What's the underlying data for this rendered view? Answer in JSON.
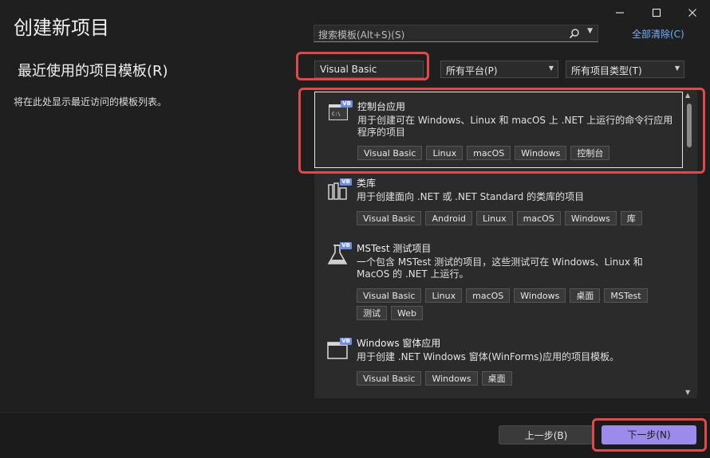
{
  "window": {
    "title": "创建新项目",
    "controls": [
      "minimize-icon",
      "maximize-icon",
      "close-icon"
    ]
  },
  "left": {
    "section_title": "最近使用的项目模板(R)",
    "section_desc": "将在此处显示最近访问的模板列表。"
  },
  "search": {
    "placeholder": "搜索模板(Alt+S)(S)",
    "clear_all": "全部清除(C)"
  },
  "filters": {
    "language": "Visual Basic",
    "platform": "所有平台(P)",
    "project_type": "所有项目类型(T)"
  },
  "templates": [
    {
      "name": "控制台应用",
      "desc": "用于创建可在 Windows、Linux 和 macOS 上 .NET 上运行的命令行应用程序的项目",
      "tags": [
        "Visual Basic",
        "Linux",
        "macOS",
        "Windows",
        "控制台"
      ],
      "icon": "console-app-icon"
    },
    {
      "name": "类库",
      "desc": "用于创建面向 .NET 或 .NET Standard 的类库的项目",
      "tags": [
        "Visual Basic",
        "Android",
        "Linux",
        "macOS",
        "Windows",
        "库"
      ],
      "icon": "class-library-icon"
    },
    {
      "name": "MSTest 测试项目",
      "desc": "一个包含 MSTest 测试的项目，这些测试可在 Windows、Linux 和 MacOS 的 .NET 上运行。",
      "tags": [
        "Visual Basic",
        "Linux",
        "macOS",
        "Windows",
        "桌面",
        "MSTest",
        "测试",
        "Web"
      ],
      "icon": "flask-icon"
    },
    {
      "name": "Windows 窗体应用",
      "desc": "用于创建 .NET Windows 窗体(WinForms)应用的项目模板。",
      "tags": [
        "Visual Basic",
        "Windows",
        "桌面"
      ],
      "icon": "winforms-icon"
    }
  ],
  "vb_badge": "VB",
  "console_glyph": "C:\\",
  "buttons": {
    "back": "上一步(B)",
    "next": "下一步(N)"
  },
  "colors": {
    "background": "#1f1f1f",
    "panel": "#2b2b2b",
    "accent": "#9c8bea",
    "link": "#6fb3ff",
    "highlight": "#e0484a"
  }
}
